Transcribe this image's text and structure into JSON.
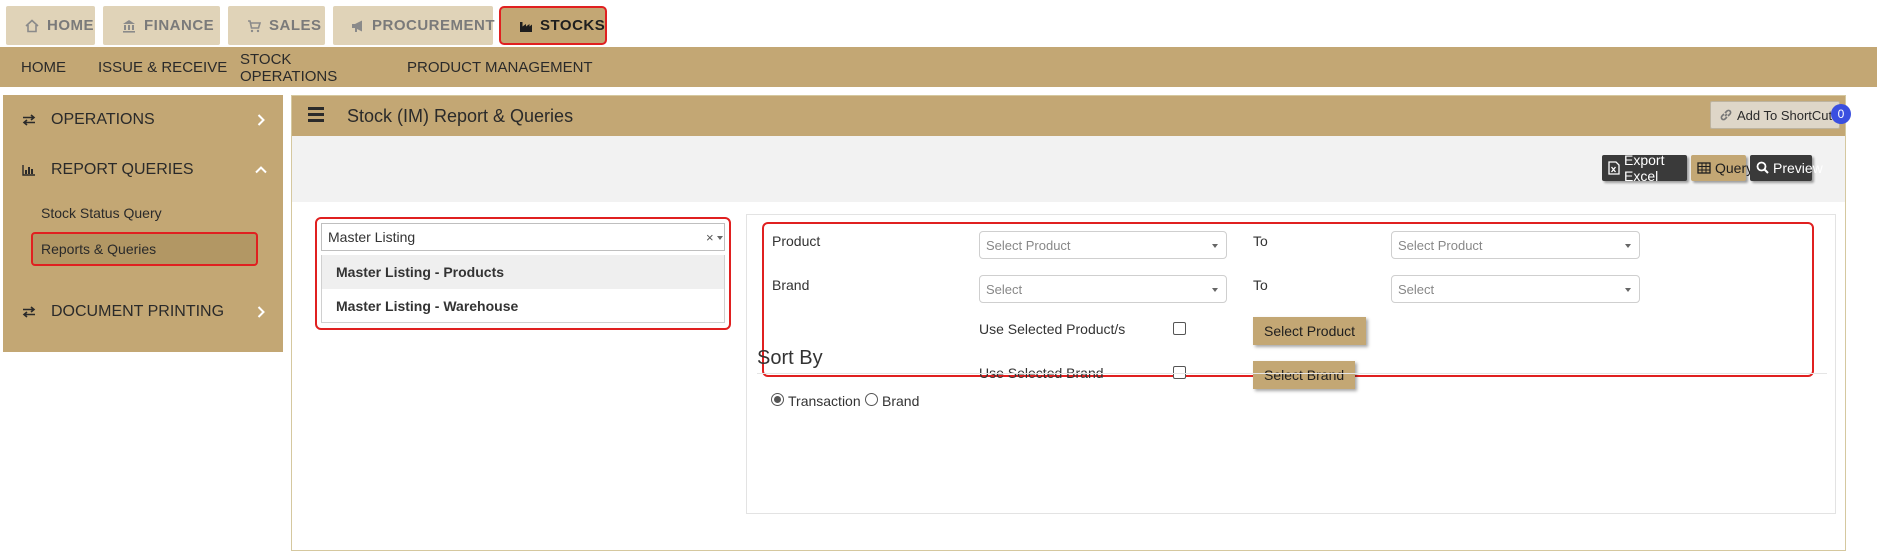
{
  "module_tabs": [
    {
      "label": "HOME",
      "icon": "home-icon"
    },
    {
      "label": "FINANCE",
      "icon": "bank-icon"
    },
    {
      "label": "SALES",
      "icon": "cart-icon"
    },
    {
      "label": "PROCUREMENT",
      "icon": "bullhorn-icon"
    },
    {
      "label": "STOCKS",
      "icon": "factory-icon",
      "active": true
    }
  ],
  "subnav": [
    {
      "label": "HOME"
    },
    {
      "label": "ISSUE & RECEIVE"
    },
    {
      "label": "STOCK OPERATIONS",
      "active": true
    },
    {
      "label": "PRODUCT MANAGEMENT"
    }
  ],
  "sidebar": {
    "sections": [
      {
        "label": "OPERATIONS",
        "icon": "exchange-icon",
        "chevron": "chevron-right-icon"
      },
      {
        "label": "REPORT QUERIES",
        "icon": "bar-chart-icon",
        "chevron": "chevron-up-icon"
      },
      {
        "label": "DOCUMENT PRINTING",
        "icon": "exchange-icon",
        "chevron": "chevron-right-icon"
      }
    ],
    "sub_items": [
      {
        "label": "Stock Status Query"
      },
      {
        "label": "Reports & Queries",
        "active": true
      }
    ]
  },
  "header": {
    "title": "Stock (IM) Report & Queries",
    "shortcut_label": "Add To ShortCut",
    "shortcut_count": "0"
  },
  "toolbar": {
    "export_label": "Export Excel",
    "query_label": "Query",
    "preview_label": "Preview"
  },
  "report_select": {
    "value": "Master Listing",
    "clear": "×",
    "options": [
      "Master Listing - Products",
      "Master Listing - Warehouse"
    ]
  },
  "filters": {
    "product_label": "Product",
    "product_placeholder": "Select Product",
    "to_label": "To",
    "brand_label": "Brand",
    "brand_placeholder": "Select",
    "use_products_label": "Use Selected Product/s",
    "use_brand_label": "Use Selected Brand",
    "select_product_btn": "Select Product",
    "select_brand_btn": "Select Brand"
  },
  "sort": {
    "title": "Sort By",
    "options": [
      {
        "label": "Transaction",
        "selected": true
      },
      {
        "label": "Brand",
        "selected": false
      }
    ]
  },
  "colors": {
    "accent": "#c3a774",
    "tab_inactive": "#e0d3b8",
    "highlight_border": "#e02020",
    "badge": "#3a4fe0"
  }
}
